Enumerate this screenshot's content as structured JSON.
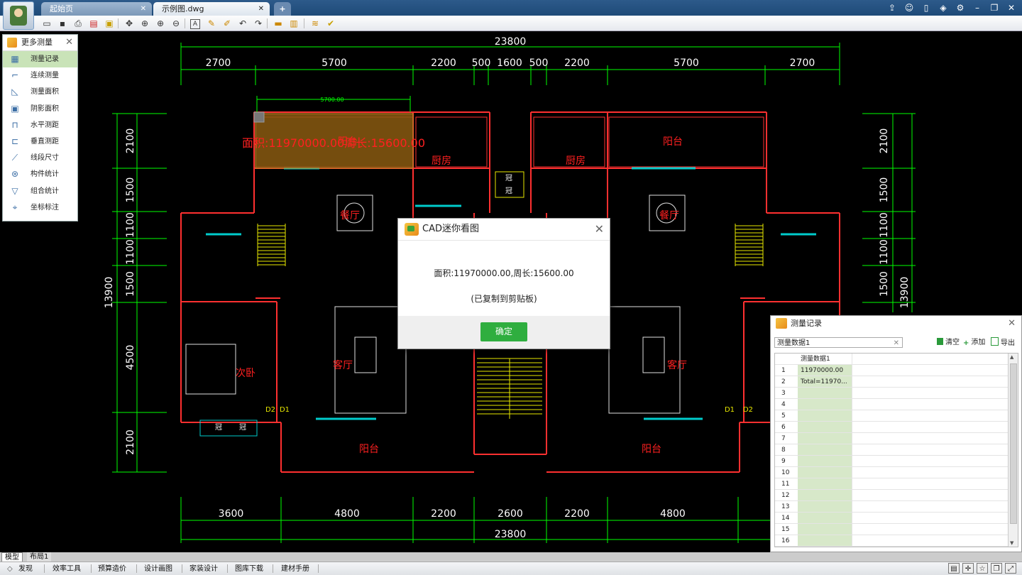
{
  "titlebar": {
    "tabs": [
      {
        "label": "起始页",
        "close": "✕"
      },
      {
        "label": "示例图.dwg",
        "close": "✕"
      }
    ],
    "new_tab": "+",
    "controls": [
      "share-icon",
      "chat-icon",
      "mobile-icon",
      "skin-icon",
      "gear-icon",
      "minimize-icon",
      "restore-icon",
      "close-icon"
    ]
  },
  "toolbar": {
    "icons": [
      "open-icon",
      "save-icon",
      "print-icon",
      "pdf-icon",
      "lock-icon",
      "pan-icon",
      "zoom-window-icon",
      "zoom-in-icon",
      "zoom-out-icon",
      "text-icon",
      "pen-icon",
      "brush-icon",
      "undo-icon",
      "redo-icon",
      "measure-icon",
      "layer-color-icon",
      "layers-icon",
      "check-icon"
    ]
  },
  "measure_panel": {
    "title": "更多测量",
    "close": "✕",
    "items": [
      {
        "label": "测量记录",
        "icon": "table-icon",
        "selected": true
      },
      {
        "label": "连续测量",
        "icon": "polyline-icon",
        "selected": false
      },
      {
        "label": "测量面积",
        "icon": "area-icon",
        "selected": false
      },
      {
        "label": "阴影面积",
        "icon": "hatch-area-icon",
        "selected": false
      },
      {
        "label": "水平测距",
        "icon": "horizontal-distance-icon",
        "selected": false
      },
      {
        "label": "垂直测距",
        "icon": "vertical-distance-icon",
        "selected": false
      },
      {
        "label": "线段尺寸",
        "icon": "segment-dimension-icon",
        "selected": false
      },
      {
        "label": "构件统计",
        "icon": "component-count-icon",
        "selected": false
      },
      {
        "label": "组合统计",
        "icon": "combined-count-icon",
        "selected": false
      },
      {
        "label": "坐标标注",
        "icon": "coordinate-icon",
        "selected": false
      }
    ]
  },
  "drawing": {
    "top_total": "23800",
    "top_segments": [
      "2700",
      "5700",
      "2200",
      "500",
      "1600",
      "500",
      "2200",
      "5700",
      "2700"
    ],
    "bottom_total": "23800",
    "bottom_segments": [
      "3600",
      "4800",
      "2200",
      "2600",
      "2200",
      "4800"
    ],
    "left_segments": [
      "2100",
      "1500",
      "1100",
      "1100",
      "1500",
      "4500",
      "2100"
    ],
    "left_total": "13900",
    "right_segments": [
      "2100",
      "1500",
      "1100",
      "1100",
      "1500"
    ],
    "right_total": "13900",
    "measure_dim": "5700.00",
    "measure_overlay": "面积:11970000.00周长:15600.00",
    "rooms": [
      "阳台",
      "厨房",
      "厨房",
      "阳台",
      "餐厅",
      "餐厅",
      "次卧",
      "客厅",
      "客厅",
      "阳台",
      "阳台"
    ],
    "door_labels": [
      "D2",
      "D1",
      "D1",
      "D2"
    ],
    "small_labels": [
      "冠",
      "冠",
      "冠",
      "冠"
    ]
  },
  "dialog": {
    "title": "CAD迷你看图",
    "close": "✕",
    "message": "面积:11970000.00,周长:15600.00",
    "note": "(已复制到剪贴板)",
    "ok": "确定"
  },
  "record_panel": {
    "title": "测量记录",
    "close": "✕",
    "selected_data": "测量数据1",
    "select_clear": "✕",
    "actions": {
      "clear": "清空",
      "add": "添加",
      "export": "导出"
    },
    "column_header": "测量数据1",
    "rows": [
      {
        "n": "1",
        "v": "11970000.00"
      },
      {
        "n": "2",
        "v": "Total=11970..."
      },
      {
        "n": "3",
        "v": ""
      },
      {
        "n": "4",
        "v": ""
      },
      {
        "n": "5",
        "v": ""
      },
      {
        "n": "6",
        "v": ""
      },
      {
        "n": "7",
        "v": ""
      },
      {
        "n": "8",
        "v": ""
      },
      {
        "n": "9",
        "v": ""
      },
      {
        "n": "10",
        "v": ""
      },
      {
        "n": "11",
        "v": ""
      },
      {
        "n": "12",
        "v": ""
      },
      {
        "n": "13",
        "v": ""
      },
      {
        "n": "14",
        "v": ""
      },
      {
        "n": "15",
        "v": ""
      },
      {
        "n": "16",
        "v": ""
      }
    ]
  },
  "layout_tabs": [
    "模型",
    "布局1"
  ],
  "bottom_bar": {
    "items": [
      "发现",
      "效率工具",
      "预算造价",
      "设计画图",
      "家装设计",
      "图库下载",
      "建材手册"
    ],
    "right_icons": [
      "model-space-icon",
      "grid-icon",
      "star-icon",
      "copy-icon",
      "fullscreen-icon"
    ]
  },
  "colors": {
    "dim_green": "#00ff00",
    "wall_red": "#ff3030",
    "window_cyan": "#00cccc",
    "stair_yellow": "#e8e800",
    "label_red": "#ff2020",
    "highlight": "#8a5a10",
    "ok_green": "#2fae3f"
  }
}
